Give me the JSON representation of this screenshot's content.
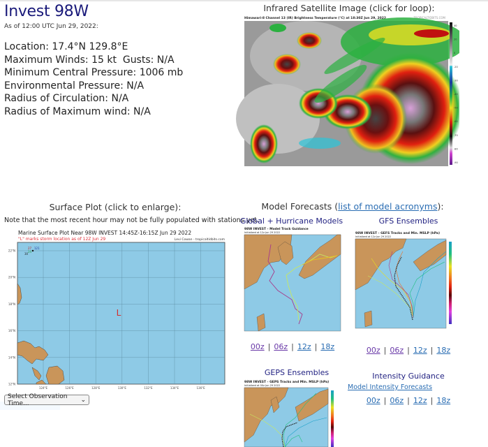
{
  "storm": {
    "title": "Invest 98W",
    "as_of": "As of 12:00 UTC Jun 29, 2022:",
    "info_lines": [
      "Location: 17.4°N 129.8°E",
      "Maximum Winds: 15 kt  Gusts: N/A",
      "Minimum Central Pressure: 1006 mb",
      "Environmental Pressure: N/A",
      "Radius of Circulation: N/A",
      "Radius of Maximum wind: N/A"
    ]
  },
  "satellite": {
    "title": "Infrared Satellite Image (click for loop):",
    "image_caption": "Himawari-8 Channel 13 (IR) Brightness Temperature (°C) at 18:30Z Jun 29, 2022",
    "credit": "TROPICALTIDBITS.COM",
    "colorbar_ticks": [
      "40",
      "20",
      "0",
      "-20",
      "-30",
      "-40",
      "-50",
      "-60",
      "-70",
      "-80",
      "-90"
    ]
  },
  "surface": {
    "title": "Surface Plot (click to enlarge):",
    "note": "Note that the most recent hour may not be fully populated with stations yet.",
    "plot_title": "Marine Surface Plot Near 98W INVEST 14:45Z-16:15Z Jun 29 2022",
    "plot_subtitle": "\"L\" marks storm location as of 12Z Jun 29",
    "credit": "Levi Cowan - tropicaltidbits.com",
    "lat_ticks": [
      "22°N",
      "20°N",
      "18°N",
      "16°N",
      "14°N",
      "12°N"
    ],
    "lon_ticks": [
      "124°E",
      "126°E",
      "128°E",
      "130°E",
      "132°E",
      "134°E",
      "136°E"
    ],
    "storm_marker": "L",
    "station": {
      "temp": "27",
      "pressure": "121",
      "dew": "24",
      "vis": "30"
    },
    "select_label": "Select Observation Time...",
    "select_arrow": "⌄"
  },
  "models": {
    "title_prefix": "Model Forecasts (",
    "title_link": "list of model acronyms",
    "title_suffix": "):",
    "global": {
      "title": "Global + Hurricane Models",
      "image_title": "98W INVEST - Model Track Guidance",
      "image_sub": "Initialized at 12z Jun 29 2022",
      "runs": [
        "00z",
        "06z",
        "12z",
        "18z"
      ]
    },
    "gefs": {
      "title": "GFS Ensembles",
      "image_title": "98W INVEST - GEFS Tracks and Min. MSLP (hPa)",
      "image_sub": "Initialized at 12z Jun 29 2022",
      "runs": [
        "00z",
        "06z",
        "12z",
        "18z"
      ]
    },
    "geps": {
      "title": "GEPS Ensembles",
      "image_title": "98W INVEST - GEPS Tracks and Min. MSLP (hPa)",
      "image_sub": "Initialized at 00z Jun 29 2022"
    },
    "intensity": {
      "title": "Intensity Guidance",
      "link": "Model Intensity Forecasts",
      "runs": [
        "00z",
        "06z",
        "12z",
        "18z"
      ]
    },
    "run_separator": "|"
  },
  "colors": {
    "title": "#1a1a7a",
    "link": "#2a6db3",
    "visited_link": "#6a3aa8",
    "ocean": "#8ecae6",
    "land": "#c9955a",
    "storm_marker": "#d62a2a"
  }
}
